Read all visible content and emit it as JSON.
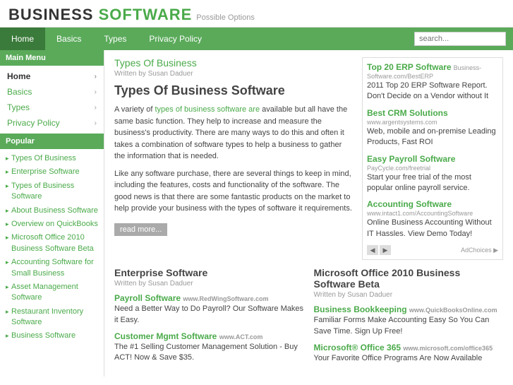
{
  "header": {
    "logo_main": "BUSINESS SOFTWARE",
    "logo_possible": "Possible Options",
    "logo_bs_text": "BUSINESS",
    "logo_sw_text": "SOFTWARE"
  },
  "navbar": {
    "items": [
      {
        "label": "Home",
        "active": true
      },
      {
        "label": "Basics",
        "active": false
      },
      {
        "label": "Types",
        "active": false
      },
      {
        "label": "Privacy Policy",
        "active": false
      }
    ],
    "search_placeholder": "search..."
  },
  "sidebar": {
    "main_menu_title": "Main Menu",
    "menu_items": [
      {
        "label": "Home",
        "active": true
      },
      {
        "label": "Basics",
        "active": false
      },
      {
        "label": "Types",
        "active": false
      },
      {
        "label": "Privacy Policy",
        "active": false
      }
    ],
    "popular_title": "Popular",
    "popular_items": [
      "Types Of Business",
      "Enterprise Software",
      "Types of Business Software",
      "About Business Software",
      "Overview on QuickBooks",
      "Microsoft Office 2010 Business Software Beta",
      "Accounting Software for Small Business",
      "Asset Management Software",
      "Restaurant Inventory Software",
      "Business Software"
    ]
  },
  "main_article": {
    "page_title": "Types Of Business",
    "written_by": "Written by Susan Daduer",
    "title": "Types Of Business Software",
    "body1": "A variety of types of business software are available but all have the same basic function. They help to increase and measure the business's productivity. There are many ways to do this and often it takes a combination of software types to help a business to gather the information that is needed.",
    "body2": "Like any software purchase, there are several things to keep in mind, including the features, costs and functionality of the software. The good news is that there are some fantastic products on the market to help provide your business with the types of software it requirements.",
    "read_more": "read more..."
  },
  "ads": {
    "items": [
      {
        "title": "Top 20 ERP Software",
        "url": "Business-Software.com/BestERP",
        "desc": "2011 Top 20 ERP Software Report. Don't Decide on a Vendor without It"
      },
      {
        "title": "Best CRM Solutions",
        "url": "www.argentsystems.com",
        "desc": "Web, mobile and on-premise Leading Products, Fast ROI"
      },
      {
        "title": "Easy Payroll Software",
        "url": "PayCycle.com/freetrial",
        "desc": "Start your free trial of the most popular online payroll service."
      },
      {
        "title": "Accounting Software",
        "url": "www.intact1.com/AccountingSoftware",
        "desc": "Online Business Accounting Without IT Hassles. View Demo Today!"
      }
    ],
    "ad_choices": "AdChoices ▶"
  },
  "enterprise_article": {
    "title": "Enterprise Software",
    "written_by": "Written by Susan Daduer",
    "links": [
      {
        "label": "Payroll Software",
        "url": "www.RedWingSoftware.com",
        "desc": "Need a Better Way to Do Payroll? Our Software Makes it Easy."
      },
      {
        "label": "Customer Mgmt Software",
        "url": "www.ACT.com",
        "desc": "The #1 Selling Customer Management Solution - Buy ACT! Now & Save $35."
      }
    ]
  },
  "microsoft_article": {
    "title": "Microsoft Office 2010 Business Software Beta",
    "written_by": "Written by Susan Daduer",
    "links": [
      {
        "label": "Business Bookkeeping",
        "url": "www.QuickBooksOnline.com",
        "desc": "Familiar Forms Make Accounting Easy So You Can Save Time. Sign Up Free!"
      },
      {
        "label": "Microsoft® Office 365",
        "url": "www.microsoft.com/office365",
        "desc": "Your Favorite Office Programs Are Now Available"
      }
    ]
  }
}
